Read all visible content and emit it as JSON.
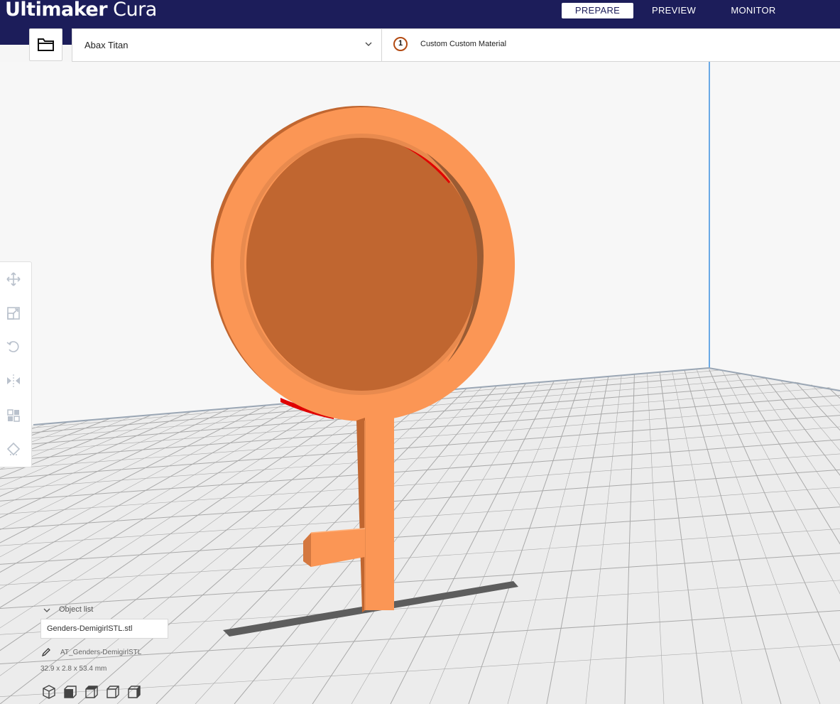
{
  "app": {
    "brand_bold": "Ultimaker",
    "brand_light": "Cura"
  },
  "nav": {
    "tabs": [
      {
        "label": "PREPARE",
        "active": true
      },
      {
        "label": "PREVIEW",
        "active": false
      },
      {
        "label": "MONITOR",
        "active": false
      }
    ]
  },
  "printer": {
    "name": "Abax Titan"
  },
  "material": {
    "extruder_number": "1",
    "label": "Custom Custom Material"
  },
  "toolbar": {
    "tools": [
      "move-icon",
      "scale-icon",
      "rotate-icon",
      "mirror-icon",
      "per-model-settings-icon",
      "support-blocker-icon"
    ]
  },
  "object_list": {
    "title": "Object list",
    "items": [
      "Genders-DemigirlSTL.stl"
    ],
    "selected_name": "AT_Genders-DemigirlSTL",
    "dimensions": "32.9 x 2.8 x 53.4 mm"
  },
  "view_buttons": [
    "3d-view-icon",
    "front-view-icon",
    "top-view-icon",
    "left-view-icon",
    "right-view-icon"
  ],
  "colors": {
    "header": "#1c1d5a",
    "model": "#fb9655",
    "model_shadow": "#c86a33",
    "overhang": "#e00000",
    "grid": "#9a9a9a",
    "volume_edge": "#2d8ce0"
  }
}
